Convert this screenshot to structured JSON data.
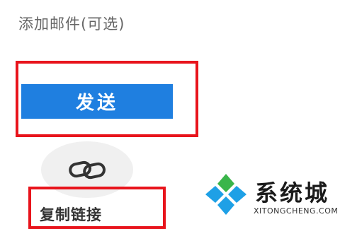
{
  "add_email_label": "添加邮件(可选)",
  "send_button_label": "发送",
  "copy_link_label": "复制链接",
  "watermark": {
    "title": "系统城",
    "subtitle": "XITONGCHENG.COM"
  },
  "icons": {
    "link": "link-icon",
    "logo": "xitongcheng-logo-icon"
  },
  "colors": {
    "accent": "#1f7fe0",
    "highlight": "#e8141c",
    "logo_blue": "#1ea0e6",
    "logo_green": "#3ab54a"
  }
}
